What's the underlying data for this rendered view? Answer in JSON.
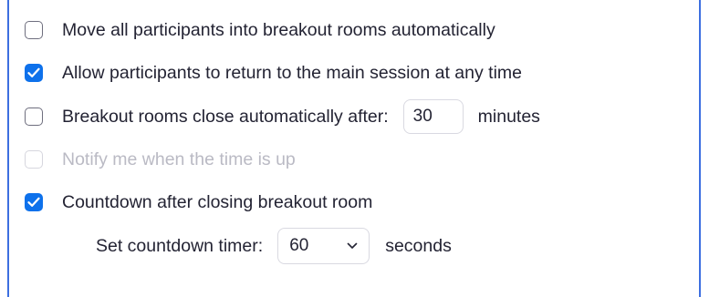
{
  "options": {
    "auto_move": {
      "label": "Move all participants into breakout rooms automatically",
      "checked": false
    },
    "allow_return": {
      "label": "Allow participants to return to the main session at any time",
      "checked": true
    },
    "auto_close": {
      "label": "Breakout rooms close automatically after:",
      "checked": false,
      "value": "30",
      "unit": "minutes"
    },
    "notify": {
      "label": "Notify me when the time is up",
      "checked": false,
      "disabled": true
    },
    "countdown": {
      "label": "Countdown after closing breakout room",
      "checked": true
    },
    "countdown_timer": {
      "label": "Set countdown timer:",
      "selected": "60",
      "unit": "seconds"
    }
  },
  "colors": {
    "accent": "#0e71eb",
    "border_focus": "#3d6fe0",
    "text": "#232333",
    "disabled_text": "#babac4"
  },
  "icons": {
    "checkmark": "check-icon",
    "dropdown": "chevron-down-icon"
  }
}
